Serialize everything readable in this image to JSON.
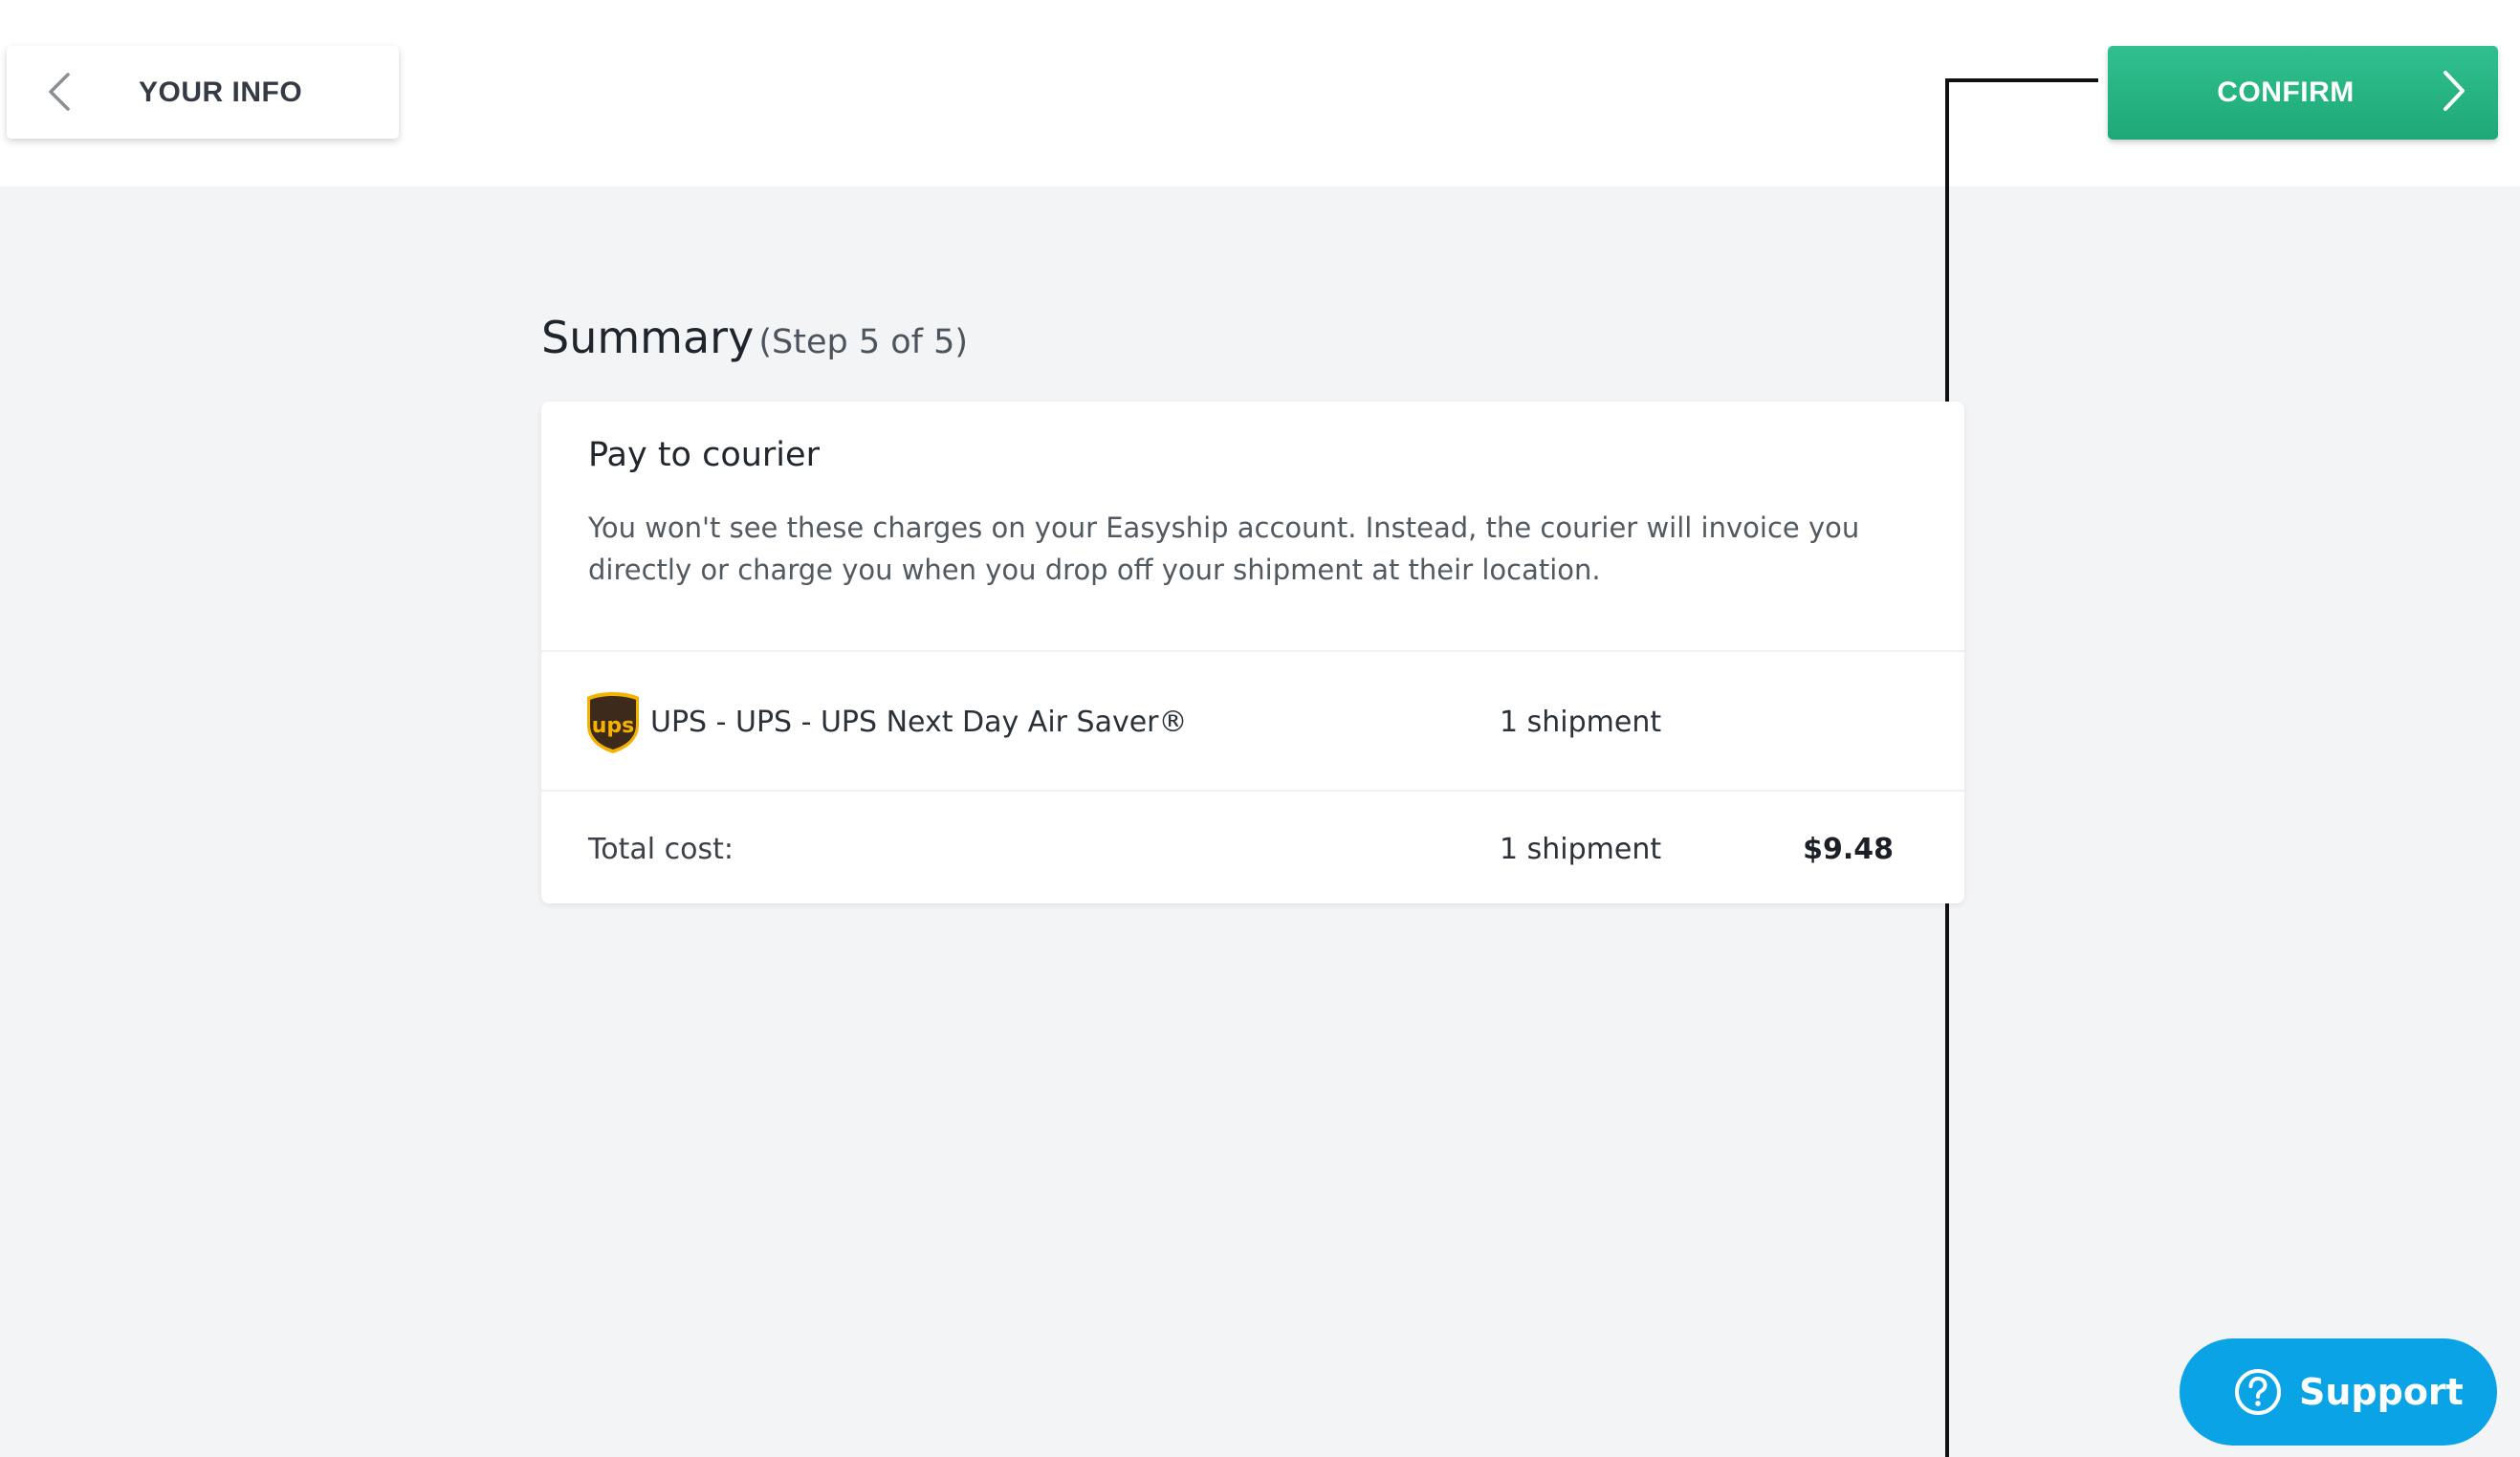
{
  "header": {
    "back_label": "YOUR INFO",
    "confirm_label": "CONFIRM"
  },
  "summary": {
    "title": "Summary",
    "step": "(Step 5 of 5)"
  },
  "card": {
    "heading": "Pay to courier",
    "description": "You won't see these charges on your Easyship account. Instead, the courier will invoice you directly or charge you when you drop off your shipment at their location.",
    "courier": {
      "icon": "ups-logo-icon",
      "logo_text": "ups",
      "name": "UPS - UPS - UPS Next Day Air Saver®",
      "count": "1 shipment"
    },
    "total": {
      "label": "Total cost:",
      "count": "1 shipment",
      "price": "$9.48"
    }
  },
  "support": {
    "label": "Support",
    "icon": "question-circle-icon"
  },
  "colors": {
    "confirm_green": "#22b07f",
    "support_blue": "#0aa3e6",
    "ups_brown": "#3d2a1b",
    "ups_gold": "#f5b300"
  }
}
